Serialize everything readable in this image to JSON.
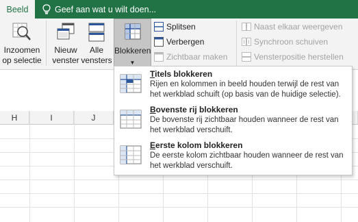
{
  "tabs": {
    "active_tab": "Beeld",
    "tell_me_placeholder": "Geef aan wat u wilt doen..."
  },
  "ribbon": {
    "zoom_selection": [
      "Inzoomen",
      "op selectie"
    ],
    "new_window": [
      "Nieuw",
      "venster"
    ],
    "arrange_all": [
      "Alle",
      "vensters"
    ],
    "freeze_panes": "Blokkeren",
    "split": "Splitsen",
    "hide": "Verbergen",
    "unhide": "Zichtbaar maken",
    "view_side_by_side": "Naast elkaar weergeven",
    "synchronous_scrolling": "Synchroon schuiven",
    "reset_window_position": "Vensterpositie herstellen"
  },
  "sheet": {
    "column_headers": [
      "H",
      "I",
      "J"
    ]
  },
  "freeze_menu": {
    "items": [
      {
        "title_key": "T",
        "title_rest": "itels blokkeren",
        "description": "Rijen en kolommen in beeld houden terwijl de rest van het werkblad schuift (op basis van de huidige selectie)."
      },
      {
        "title_key": "B",
        "title_rest": "ovenste rij blokkeren",
        "description": "De bovenste rij zichtbaar houden wanneer de rest van het werkblad verschuift."
      },
      {
        "title_key": "E",
        "title_rest": "erste kolom blokkeren",
        "description": "De eerste kolom zichtbaar houden wanneer de rest van het werkblad verschuift."
      }
    ]
  },
  "colors": {
    "accent_green": "#217346",
    "ribbon_bg": "#f3f3f3",
    "selected_button_bg": "#c5c5c5",
    "icon_blue": "#2b579a"
  }
}
